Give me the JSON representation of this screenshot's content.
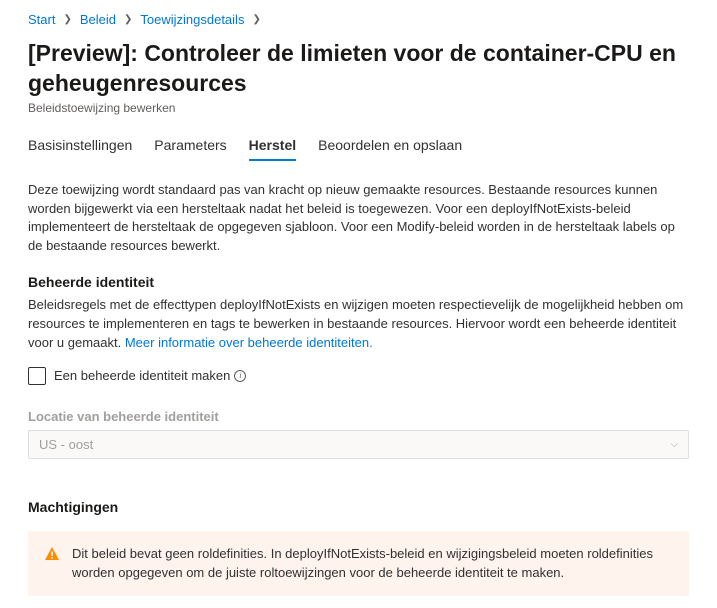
{
  "breadcrumb": {
    "start": "Start",
    "beleid": "Beleid",
    "details": "Toewijzingsdetails"
  },
  "header": {
    "title": "[Preview]: Controleer de limieten voor de container-CPU en geheugenresources",
    "subtitle": "Beleidstoewijzing bewerken"
  },
  "tabs": {
    "basic": "Basisinstellingen",
    "parameters": "Parameters",
    "remediation": "Herstel",
    "review": "Beoordelen en opslaan"
  },
  "description": "Deze toewijzing wordt standaard pas van kracht op nieuw gemaakte resources. Bestaande resources kunnen worden bijgewerkt via een hersteltaak nadat het beleid is toegewezen. Voor een deployIfNotExists-beleid implementeert de hersteltaak de opgegeven sjabloon. Voor een Modify-beleid worden in de hersteltaak labels op de bestaande resources bewerkt.",
  "managedIdentity": {
    "title": "Beheerde identiteit",
    "text": "Beleidsregels met de effecttypen deployIfNotExists en wijzigen moeten respectievelijk de mogelijkheid hebben om resources te implementeren en tags te bewerken in bestaande resources. Hiervoor wordt een beheerde identiteit voor u gemaakt.",
    "link": "Meer informatie over beheerde identiteiten.",
    "checkboxLabel": "Een beheerde identiteit maken",
    "locationLabel": "Locatie van beheerde identiteit",
    "locationValue": "US - oost"
  },
  "permissions": {
    "title": "Machtigingen",
    "warning": "Dit beleid bevat geen roldefinities. In deployIfNotExists-beleid en wijzigingsbeleid moeten roldefinities worden opgegeven om de juiste roltoewijzingen voor de beheerde identiteit te maken."
  }
}
